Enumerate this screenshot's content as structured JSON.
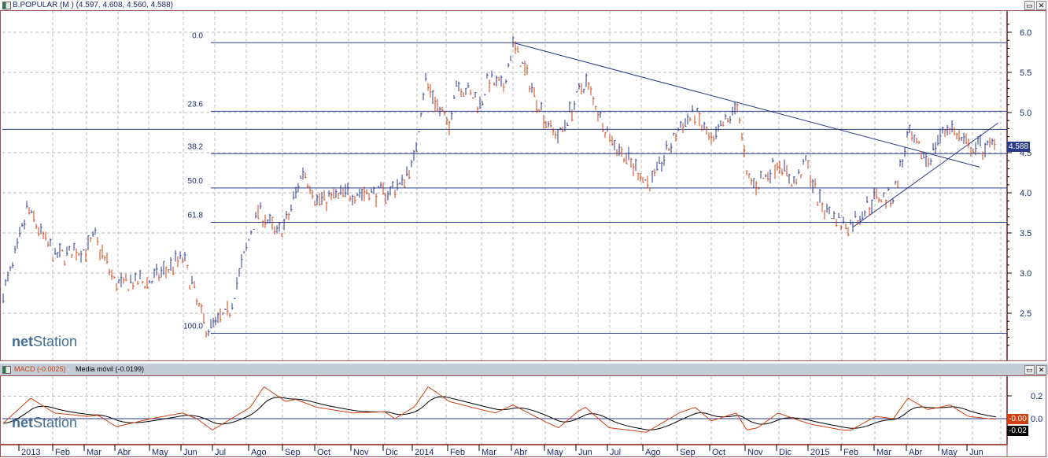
{
  "window": {
    "title": "B.POPULAR (M ) (4.597, 4.608, 4.560, 4.588)",
    "restore": "▭",
    "close": "✕"
  },
  "logo": {
    "text_a": "net",
    "text_b": "Station"
  },
  "macd_header": {
    "macd": "MACD (-0.0025)",
    "sep": " - ",
    "signal": "Media móvil (-0.0199)"
  },
  "tags": {
    "price": "4.588",
    "macd": "-0.00",
    "signal": "-0.02"
  },
  "colors": {
    "up": "#2a3a8c",
    "down": "#d04010",
    "macd": "#d04010",
    "signal": "#000000",
    "fib": "#2a3a8c",
    "tag_price": "#2a3a8c"
  },
  "chart_data": [
    {
      "type": "ohlc",
      "title": "B.POPULAR (M )",
      "last": {
        "open": 4.597,
        "high": 4.608,
        "low": 4.56,
        "close": 4.588
      },
      "yticks": [
        "6.0",
        "5.5",
        "5.0",
        "4.5",
        "4.0",
        "3.5",
        "3.0",
        "2.5"
      ],
      "ylim": [
        2.05,
        6.15
      ],
      "xticks": [
        "2013",
        "Feb",
        "Mar",
        "Abr",
        "May",
        "Jun",
        "Jul",
        "Ago",
        "Sep",
        "Oct",
        "Nov",
        "Dic",
        "2014",
        "Feb",
        "Mar",
        "Abr",
        "May",
        "Jun",
        "Jul",
        "Ago",
        "Sep",
        "Oct",
        "Nov",
        "Dic",
        "2015",
        "Feb",
        "Mar",
        "Abr",
        "May",
        "Jun"
      ],
      "fibonacci": {
        "high": 5.87,
        "low": 2.25,
        "levels": [
          {
            "label": "0.0",
            "r": 0
          },
          {
            "label": "23.6",
            "r": 0.236
          },
          {
            "label": "38.2",
            "r": 0.382
          },
          {
            "label": "50.0",
            "r": 0.5
          },
          {
            "label": "61.8",
            "r": 0.618
          },
          {
            "label": "100.0",
            "r": 1
          }
        ]
      },
      "hlines": [
        4.79
      ],
      "trendlines": [
        [
          [
            15.05,
            5.87
          ],
          [
            29.45,
            4.32
          ]
        ],
        [
          [
            25.35,
            3.57
          ],
          [
            30.1,
            4.87
          ]
        ]
      ],
      "price_path": [
        [
          -0.5,
          2.7
        ],
        [
          -0.1,
          3.2
        ],
        [
          0.25,
          3.8
        ],
        [
          1.05,
          3.2
        ],
        [
          2.1,
          3.3
        ],
        [
          2.35,
          3.45
        ],
        [
          3.05,
          2.85
        ],
        [
          4.05,
          2.9
        ],
        [
          5.05,
          3.2
        ],
        [
          5.8,
          2.3
        ],
        [
          6.45,
          2.5
        ],
        [
          7.05,
          3.5
        ],
        [
          7.3,
          3.8
        ],
        [
          7.8,
          3.5
        ],
        [
          8.1,
          3.6
        ],
        [
          8.65,
          4.3
        ],
        [
          9.05,
          3.9
        ],
        [
          10.05,
          4.0
        ],
        [
          11.05,
          4.0
        ],
        [
          11.6,
          4.1
        ],
        [
          12.05,
          4.4
        ],
        [
          12.35,
          5.4
        ],
        [
          13.05,
          4.8
        ],
        [
          13.25,
          5.4
        ],
        [
          14.05,
          5.1
        ],
        [
          14.25,
          5.4
        ],
        [
          14.75,
          5.3
        ],
        [
          15.05,
          5.85
        ],
        [
          16.05,
          4.9
        ],
        [
          16.45,
          4.7
        ],
        [
          17.05,
          5.2
        ],
        [
          17.3,
          5.4
        ],
        [
          18.05,
          4.7
        ],
        [
          18.6,
          4.4
        ],
        [
          19.2,
          4.1
        ],
        [
          20.05,
          4.8
        ],
        [
          20.55,
          5.0
        ],
        [
          21.05,
          4.6
        ],
        [
          21.8,
          5.1
        ],
        [
          22.05,
          4.2
        ],
        [
          22.4,
          4.1
        ],
        [
          23.05,
          4.4
        ],
        [
          23.55,
          4.1
        ],
        [
          23.95,
          4.4
        ],
        [
          24.3,
          3.9
        ],
        [
          25.05,
          3.6
        ],
        [
          25.3,
          3.6
        ],
        [
          26.05,
          3.95
        ],
        [
          26.6,
          3.95
        ],
        [
          27.05,
          4.7
        ],
        [
          27.65,
          4.4
        ],
        [
          28.05,
          4.7
        ],
        [
          28.35,
          4.85
        ],
        [
          29.05,
          4.55
        ],
        [
          29.85,
          4.59
        ]
      ]
    },
    {
      "type": "line",
      "title": "MACD",
      "yticks": [
        "0.2",
        "0.0"
      ],
      "ylim": [
        -0.22,
        0.33
      ],
      "series": [
        {
          "name": "MACD",
          "last": -0.0025,
          "values": [
            [
              -0.5,
              -0.05
            ],
            [
              0.35,
              0.18
            ],
            [
              1.05,
              0.05
            ],
            [
              2.1,
              0.02
            ],
            [
              2.45,
              0.03
            ],
            [
              3.05,
              -0.07
            ],
            [
              4.05,
              0.0
            ],
            [
              5.05,
              0.05
            ],
            [
              5.5,
              0.0
            ],
            [
              6.0,
              -0.1
            ],
            [
              7.05,
              0.1
            ],
            [
              7.45,
              0.28
            ],
            [
              8.1,
              0.15
            ],
            [
              8.4,
              0.17
            ],
            [
              9.05,
              0.1
            ],
            [
              10.05,
              0.05
            ],
            [
              11.05,
              0.06
            ],
            [
              11.4,
              0.0
            ],
            [
              12.05,
              0.1
            ],
            [
              12.45,
              0.28
            ],
            [
              13.05,
              0.15
            ],
            [
              14.05,
              0.08
            ],
            [
              14.5,
              0.05
            ],
            [
              15.05,
              0.12
            ],
            [
              16.05,
              -0.03
            ],
            [
              16.45,
              -0.08
            ],
            [
              17.05,
              0.06
            ],
            [
              17.3,
              0.1
            ],
            [
              18.05,
              -0.08
            ],
            [
              18.6,
              -0.1
            ],
            [
              19.1,
              -0.12
            ],
            [
              20.05,
              0.05
            ],
            [
              20.55,
              0.1
            ],
            [
              21.05,
              -0.02
            ],
            [
              21.75,
              0.05
            ],
            [
              22.05,
              -0.1
            ],
            [
              22.4,
              -0.08
            ],
            [
              23.05,
              0.05
            ],
            [
              23.55,
              0.0
            ],
            [
              24.1,
              -0.05
            ],
            [
              25.05,
              -0.1
            ],
            [
              25.3,
              -0.1
            ],
            [
              26.05,
              0.02
            ],
            [
              26.6,
              0.0
            ],
            [
              27.05,
              0.18
            ],
            [
              27.65,
              0.08
            ],
            [
              28.05,
              0.1
            ],
            [
              28.4,
              0.12
            ],
            [
              29.05,
              0.02
            ],
            [
              29.85,
              -0.0025
            ]
          ]
        },
        {
          "name": "Media móvil",
          "last": -0.0199
        }
      ]
    }
  ]
}
